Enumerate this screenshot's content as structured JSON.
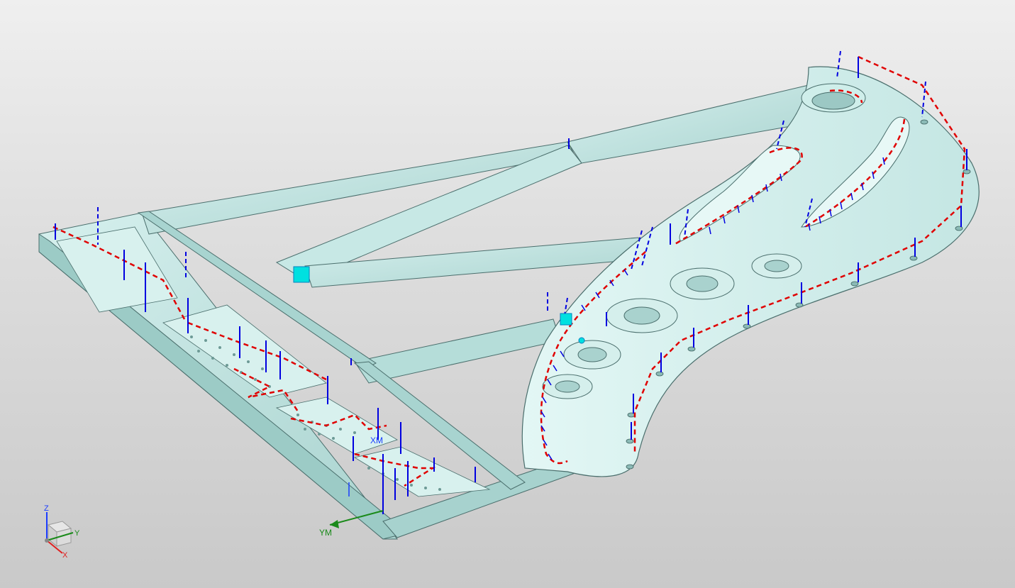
{
  "scene": {
    "background_top": "#efefef",
    "background_bottom": "#c9c9c9",
    "model_face_color": "#b9e0dc",
    "model_light_color": "#daf3f1",
    "model_edge_color": "#4a6e6c",
    "toolpath_color": "#e00000",
    "tool_axis_color": "#0000e0",
    "highlight_color": "#00e0e0"
  },
  "triad": {
    "z_label": "Z",
    "y_label": "Y",
    "x_label": "X",
    "z_color": "#1a3cff",
    "y_color": "#1a8a1a",
    "x_color": "#e02020"
  },
  "wcs": {
    "ym_label": "YM",
    "xm_label": "XM",
    "ym_color": "#1a8a1a",
    "xm_color": "#1a3cff"
  }
}
